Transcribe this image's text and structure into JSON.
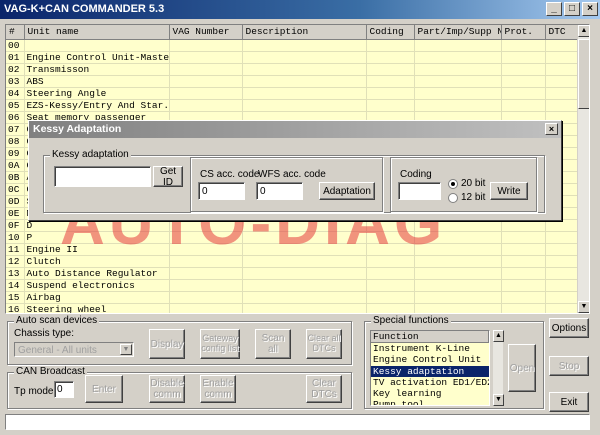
{
  "window": {
    "title": "VAG-K+CAN COMMANDER 5.3",
    "minimize": "_",
    "maximize": "□",
    "close": "×"
  },
  "grid": {
    "columns": [
      "#",
      "Unit name",
      "VAG Number",
      "Description",
      "Coding",
      "Part/Imp/Supp N",
      "Prot.",
      "DTC"
    ],
    "rows": [
      [
        "00",
        ""
      ],
      [
        "01",
        "Engine Control Unit-Master"
      ],
      [
        "02",
        "Transmisson"
      ],
      [
        "03",
        "ABS"
      ],
      [
        "04",
        "Steering Angle"
      ],
      [
        "05",
        "EZS-Kessy/Entry And Star..."
      ],
      [
        "06",
        "Seat memory passenger"
      ],
      [
        "07",
        "C"
      ],
      [
        "08",
        "C"
      ],
      [
        "09",
        "C"
      ],
      [
        "0A",
        "C"
      ],
      [
        "0B",
        "A"
      ],
      [
        "0C",
        "C"
      ],
      [
        "0D",
        "S"
      ],
      [
        "0E",
        "M"
      ],
      [
        "0F",
        "D"
      ],
      [
        "10",
        "P"
      ],
      [
        "11",
        "Engine II"
      ],
      [
        "12",
        "Clutch"
      ],
      [
        "13",
        "Auto Distance Regulator"
      ],
      [
        "14",
        "Suspend electronics"
      ],
      [
        "15",
        "Airbag"
      ],
      [
        "16",
        "Steering wheel"
      ],
      [
        "17",
        "Instrument Cluster"
      ]
    ]
  },
  "watermark": "AUTO-DIAG",
  "dialog": {
    "title": "Kessy Adaptation",
    "close": "×",
    "kessy_group": "Kessy adaptation",
    "get_id": "Get ID",
    "cs_label": "CS acc. code",
    "cs_value": "0",
    "wfs_label": "WFS acc. code",
    "wfs_value": "0",
    "adaptation": "Adaptation",
    "coding_group": "Coding",
    "bit20": "20 bit",
    "bit12": "12 bit",
    "write": "Write"
  },
  "autoscan": {
    "group": "Auto scan devices",
    "chassis_label": "Chassis type:",
    "chassis_value": "General - All units",
    "display": "Display",
    "gateway": "Gateway config list",
    "scan_all": "Scan all",
    "clear_all": "Clear all DTCs"
  },
  "canbroadcast": {
    "group": "CAN Broadcast",
    "tp_label": "Tp mode",
    "tp_value": "0",
    "enter": "Enter",
    "disable": "Disable comm",
    "enable": "Enable comm",
    "clear": "Clear DTCs"
  },
  "special": {
    "group": "Special functions",
    "header": "Function",
    "items": [
      "Instrument K-Line",
      "Engine Control Unit",
      "Kessy adaptation",
      "TV activation ED1/ED2",
      "Key learning",
      "Pump tool"
    ],
    "selected_index": 2,
    "open": "Open"
  },
  "side": {
    "options": "Options",
    "stop": "Stop",
    "exit": "Exit"
  }
}
